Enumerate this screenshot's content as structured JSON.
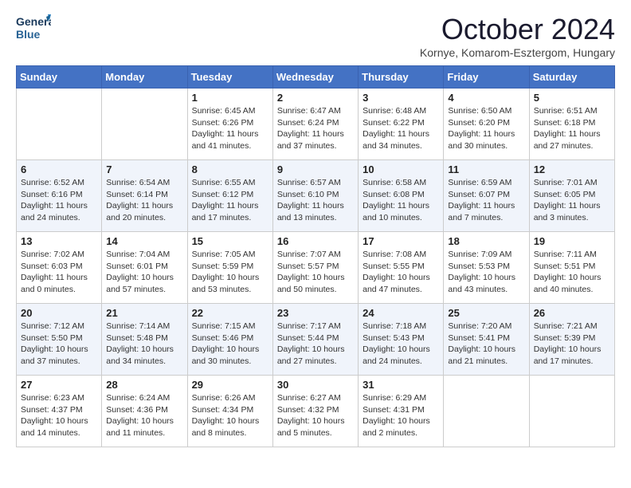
{
  "header": {
    "logo_line1": "General",
    "logo_line2": "Blue",
    "month": "October 2024",
    "location": "Kornye, Komarom-Esztergom, Hungary"
  },
  "weekdays": [
    "Sunday",
    "Monday",
    "Tuesday",
    "Wednesday",
    "Thursday",
    "Friday",
    "Saturday"
  ],
  "weeks": [
    [
      {
        "day": "",
        "content": ""
      },
      {
        "day": "",
        "content": ""
      },
      {
        "day": "1",
        "content": "Sunrise: 6:45 AM\nSunset: 6:26 PM\nDaylight: 11 hours and 41 minutes."
      },
      {
        "day": "2",
        "content": "Sunrise: 6:47 AM\nSunset: 6:24 PM\nDaylight: 11 hours and 37 minutes."
      },
      {
        "day": "3",
        "content": "Sunrise: 6:48 AM\nSunset: 6:22 PM\nDaylight: 11 hours and 34 minutes."
      },
      {
        "day": "4",
        "content": "Sunrise: 6:50 AM\nSunset: 6:20 PM\nDaylight: 11 hours and 30 minutes."
      },
      {
        "day": "5",
        "content": "Sunrise: 6:51 AM\nSunset: 6:18 PM\nDaylight: 11 hours and 27 minutes."
      }
    ],
    [
      {
        "day": "6",
        "content": "Sunrise: 6:52 AM\nSunset: 6:16 PM\nDaylight: 11 hours and 24 minutes."
      },
      {
        "day": "7",
        "content": "Sunrise: 6:54 AM\nSunset: 6:14 PM\nDaylight: 11 hours and 20 minutes."
      },
      {
        "day": "8",
        "content": "Sunrise: 6:55 AM\nSunset: 6:12 PM\nDaylight: 11 hours and 17 minutes."
      },
      {
        "day": "9",
        "content": "Sunrise: 6:57 AM\nSunset: 6:10 PM\nDaylight: 11 hours and 13 minutes."
      },
      {
        "day": "10",
        "content": "Sunrise: 6:58 AM\nSunset: 6:08 PM\nDaylight: 11 hours and 10 minutes."
      },
      {
        "day": "11",
        "content": "Sunrise: 6:59 AM\nSunset: 6:07 PM\nDaylight: 11 hours and 7 minutes."
      },
      {
        "day": "12",
        "content": "Sunrise: 7:01 AM\nSunset: 6:05 PM\nDaylight: 11 hours and 3 minutes."
      }
    ],
    [
      {
        "day": "13",
        "content": "Sunrise: 7:02 AM\nSunset: 6:03 PM\nDaylight: 11 hours and 0 minutes."
      },
      {
        "day": "14",
        "content": "Sunrise: 7:04 AM\nSunset: 6:01 PM\nDaylight: 10 hours and 57 minutes."
      },
      {
        "day": "15",
        "content": "Sunrise: 7:05 AM\nSunset: 5:59 PM\nDaylight: 10 hours and 53 minutes."
      },
      {
        "day": "16",
        "content": "Sunrise: 7:07 AM\nSunset: 5:57 PM\nDaylight: 10 hours and 50 minutes."
      },
      {
        "day": "17",
        "content": "Sunrise: 7:08 AM\nSunset: 5:55 PM\nDaylight: 10 hours and 47 minutes."
      },
      {
        "day": "18",
        "content": "Sunrise: 7:09 AM\nSunset: 5:53 PM\nDaylight: 10 hours and 43 minutes."
      },
      {
        "day": "19",
        "content": "Sunrise: 7:11 AM\nSunset: 5:51 PM\nDaylight: 10 hours and 40 minutes."
      }
    ],
    [
      {
        "day": "20",
        "content": "Sunrise: 7:12 AM\nSunset: 5:50 PM\nDaylight: 10 hours and 37 minutes."
      },
      {
        "day": "21",
        "content": "Sunrise: 7:14 AM\nSunset: 5:48 PM\nDaylight: 10 hours and 34 minutes."
      },
      {
        "day": "22",
        "content": "Sunrise: 7:15 AM\nSunset: 5:46 PM\nDaylight: 10 hours and 30 minutes."
      },
      {
        "day": "23",
        "content": "Sunrise: 7:17 AM\nSunset: 5:44 PM\nDaylight: 10 hours and 27 minutes."
      },
      {
        "day": "24",
        "content": "Sunrise: 7:18 AM\nSunset: 5:43 PM\nDaylight: 10 hours and 24 minutes."
      },
      {
        "day": "25",
        "content": "Sunrise: 7:20 AM\nSunset: 5:41 PM\nDaylight: 10 hours and 21 minutes."
      },
      {
        "day": "26",
        "content": "Sunrise: 7:21 AM\nSunset: 5:39 PM\nDaylight: 10 hours and 17 minutes."
      }
    ],
    [
      {
        "day": "27",
        "content": "Sunrise: 6:23 AM\nSunset: 4:37 PM\nDaylight: 10 hours and 14 minutes."
      },
      {
        "day": "28",
        "content": "Sunrise: 6:24 AM\nSunset: 4:36 PM\nDaylight: 10 hours and 11 minutes."
      },
      {
        "day": "29",
        "content": "Sunrise: 6:26 AM\nSunset: 4:34 PM\nDaylight: 10 hours and 8 minutes."
      },
      {
        "day": "30",
        "content": "Sunrise: 6:27 AM\nSunset: 4:32 PM\nDaylight: 10 hours and 5 minutes."
      },
      {
        "day": "31",
        "content": "Sunrise: 6:29 AM\nSunset: 4:31 PM\nDaylight: 10 hours and 2 minutes."
      },
      {
        "day": "",
        "content": ""
      },
      {
        "day": "",
        "content": ""
      }
    ]
  ]
}
